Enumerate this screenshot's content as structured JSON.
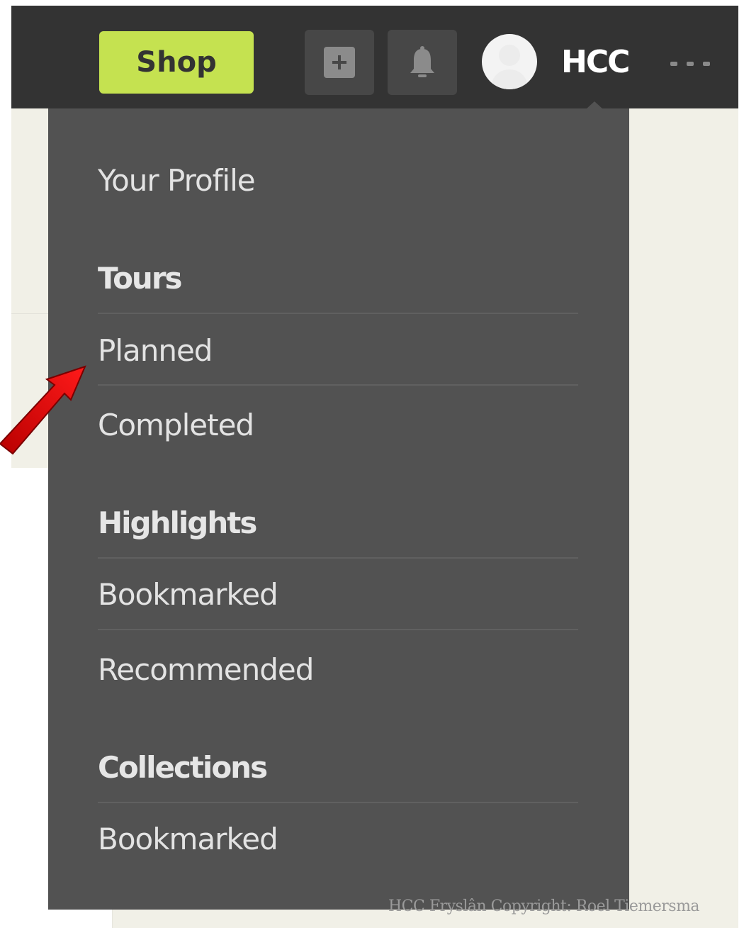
{
  "header": {
    "shop_label": "Shop",
    "add_icon": "plus-square-icon",
    "bell_icon": "bell-icon",
    "avatar_icon": "user-avatar",
    "username": "HCC",
    "more_icon": "ellipsis-icon"
  },
  "menu": {
    "profile": "Your Profile",
    "tours_heading": "Tours",
    "tours_planned": "Planned",
    "tours_completed": "Completed",
    "highlights_heading": "Highlights",
    "highlights_bookmarked": "Bookmarked",
    "highlights_recommended": "Recommended",
    "collections_heading": "Collections",
    "collections_bookmarked": "Bookmarked"
  },
  "annotation": {
    "arrow_color": "#e20000"
  },
  "watermark": "HCC Fryslân Copyright: Roel Tiemersma",
  "colors": {
    "topbar": "#333333",
    "shop_button": "#c5e250",
    "dropdown": "#525252",
    "page_background": "#f1f0e7"
  }
}
